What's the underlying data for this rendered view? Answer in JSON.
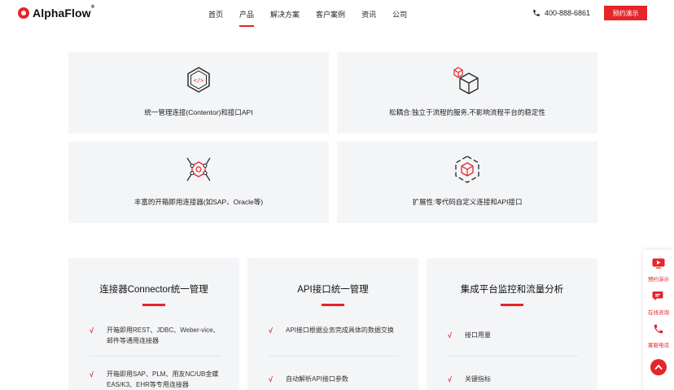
{
  "brand": {
    "name": "AlphaFlow",
    "mark": "®",
    "color": "#e5252a"
  },
  "nav": {
    "items": [
      {
        "label": "首页",
        "active": false
      },
      {
        "label": "产品",
        "active": true
      },
      {
        "label": "解决方案",
        "active": false
      },
      {
        "label": "客户案例",
        "active": false
      },
      {
        "label": "资讯",
        "active": false
      },
      {
        "label": "公司",
        "active": false
      }
    ]
  },
  "header": {
    "phone": "400-888-6861",
    "demo_label": "预约演示",
    "phone_icon": "phone-icon"
  },
  "features": [
    {
      "text": "统一管理连接(Contentor)和接口API",
      "icon": "code-hexagon-icon"
    },
    {
      "text": "松耦合:独立于流程的服务,不影响流程平台的稳定性",
      "icon": "cube-icon"
    },
    {
      "text": "丰富的开箱即用连接器(如SAP、Oracle等)",
      "icon": "network-nodes-icon"
    },
    {
      "text": "扩展性:零代码自定义连接和API接口",
      "icon": "hexagon-expand-icon"
    }
  ],
  "columns": [
    {
      "title": "连接器Connector统一管理",
      "items": [
        {
          "text": "开箱即用REST、JDBC、Weber-vice、邮件等通用连接器"
        },
        {
          "text": "开箱即用SAP、PLM、用友NC/UB金蝶EAS/K3、EHR等专用连接器"
        }
      ]
    },
    {
      "title": "API接口统一管理",
      "items": [
        {
          "text": "API接口根据业务完成具体的数据交换"
        },
        {
          "text": "自动解析API接口参数"
        }
      ]
    },
    {
      "title": "集成平台监控和流量分析",
      "items": [
        {
          "text": "接口用量"
        },
        {
          "text": "关键指标"
        }
      ]
    }
  ],
  "check_mark": "√",
  "float_bar": {
    "items": [
      {
        "label": "预约演示",
        "icon": "video-play-icon"
      },
      {
        "label": "在线咨询",
        "icon": "chat-icon"
      },
      {
        "label": "客服电话",
        "icon": "phone-icon"
      }
    ],
    "top_icon": "arrow-up-icon"
  }
}
